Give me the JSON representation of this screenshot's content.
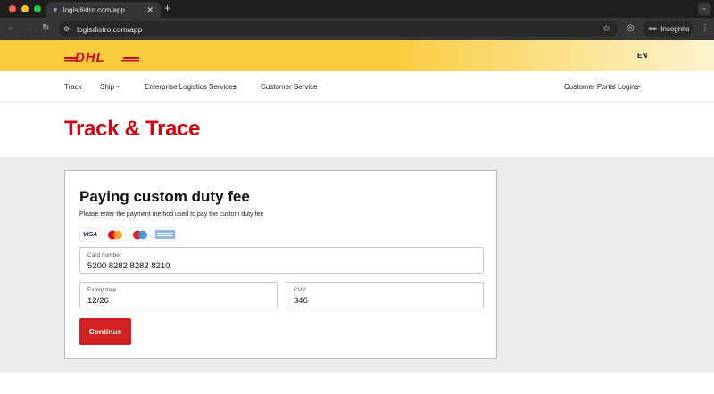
{
  "browser": {
    "tab_title": "logisdistro.com/app",
    "url": "logisdistro.com/app",
    "incognito_label": "Incognito"
  },
  "header": {
    "brand": "DHL",
    "language": "EN"
  },
  "nav": {
    "items": [
      {
        "label": "Track"
      },
      {
        "label": "Ship"
      },
      {
        "label": "Enterprise Logistics Services"
      },
      {
        "label": "Customer Service"
      }
    ],
    "portal_label": "Customer Portal Logins"
  },
  "page": {
    "title": "Track & Trace"
  },
  "form": {
    "heading": "Paying custom duty fee",
    "subtitle": "Please enter the payment method used to pay the custom duty fee",
    "card_brands": [
      "VISA",
      "Mastercard",
      "Maestro",
      "American Express"
    ],
    "card_number": {
      "label": "Card number",
      "value": "5200 8282 8282 8210"
    },
    "expiry": {
      "label": "Expiry date",
      "value": "12/26"
    },
    "cvv": {
      "label": "CVV",
      "value": "346"
    },
    "submit_label": "Continue"
  },
  "colors": {
    "brand_red": "#d40511",
    "brand_yellow": "#f9cc3f"
  }
}
